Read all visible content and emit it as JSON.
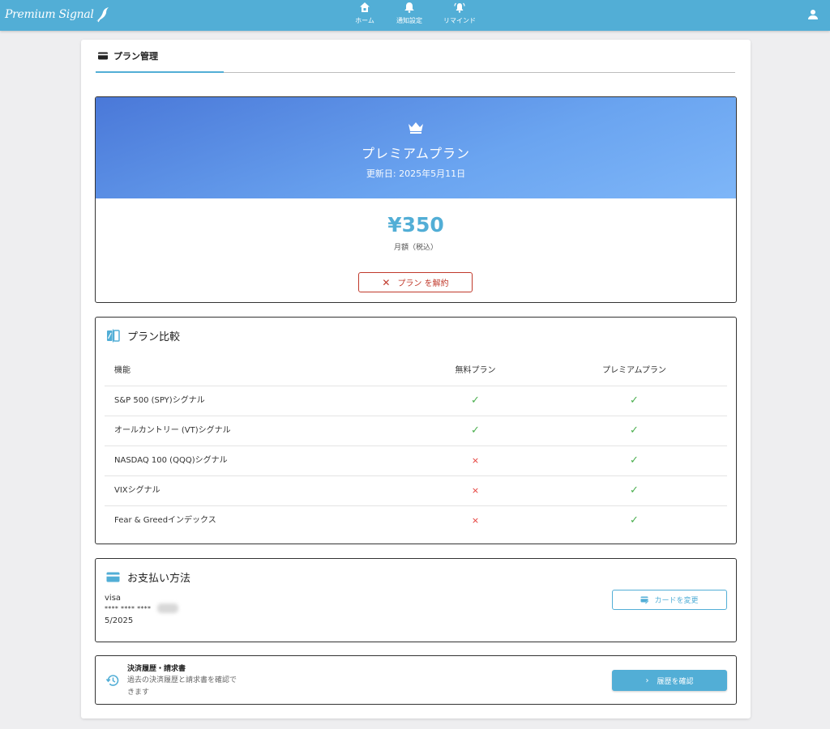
{
  "app": {
    "logo_text": "Premium Signal",
    "brand_color": "#52aed6"
  },
  "nav": [
    {
      "label": "ホーム",
      "icon": "home-icon"
    },
    {
      "label": "通知設定",
      "icon": "bell-icon"
    },
    {
      "label": "リマインド",
      "icon": "bell-ring-icon"
    }
  ],
  "tabs": [
    {
      "label": "プラン管理",
      "icon": "card-icon",
      "active": true
    }
  ],
  "plan": {
    "name": "プレミアムプラン",
    "updated": "更新日: 2025年5月11日",
    "price": "¥350",
    "price_note": "月額（税込）",
    "cancel_label": "プラン を解約"
  },
  "comparison": {
    "title": "プラン比較",
    "headers": [
      "機能",
      "無料プラン",
      "プレミアムプラン"
    ],
    "rows": [
      {
        "feature": "S&P 500 (SPY)シグナル",
        "free": "✓",
        "premium": "✓"
      },
      {
        "feature": "オールカントリー (VT)シグナル",
        "free": "✓",
        "premium": "✓"
      },
      {
        "feature": "NASDAQ 100 (QQQ)シグナル",
        "free": "×",
        "premium": "✓"
      },
      {
        "feature": "VIXシグナル",
        "free": "×",
        "premium": "✓"
      },
      {
        "feature": "Fear & Greedインデックス",
        "free": "×",
        "premium": "✓"
      }
    ]
  },
  "payment": {
    "title": "お支払い方法",
    "brand": "visa",
    "masked": "**** **** ****",
    "expiry": "5/2025",
    "change_label": "カードを変更"
  },
  "history": {
    "title": "決済履歴・請求書",
    "description": "過去の決済履歴と請求書を確認できます",
    "button_label": "履歴を確認"
  }
}
